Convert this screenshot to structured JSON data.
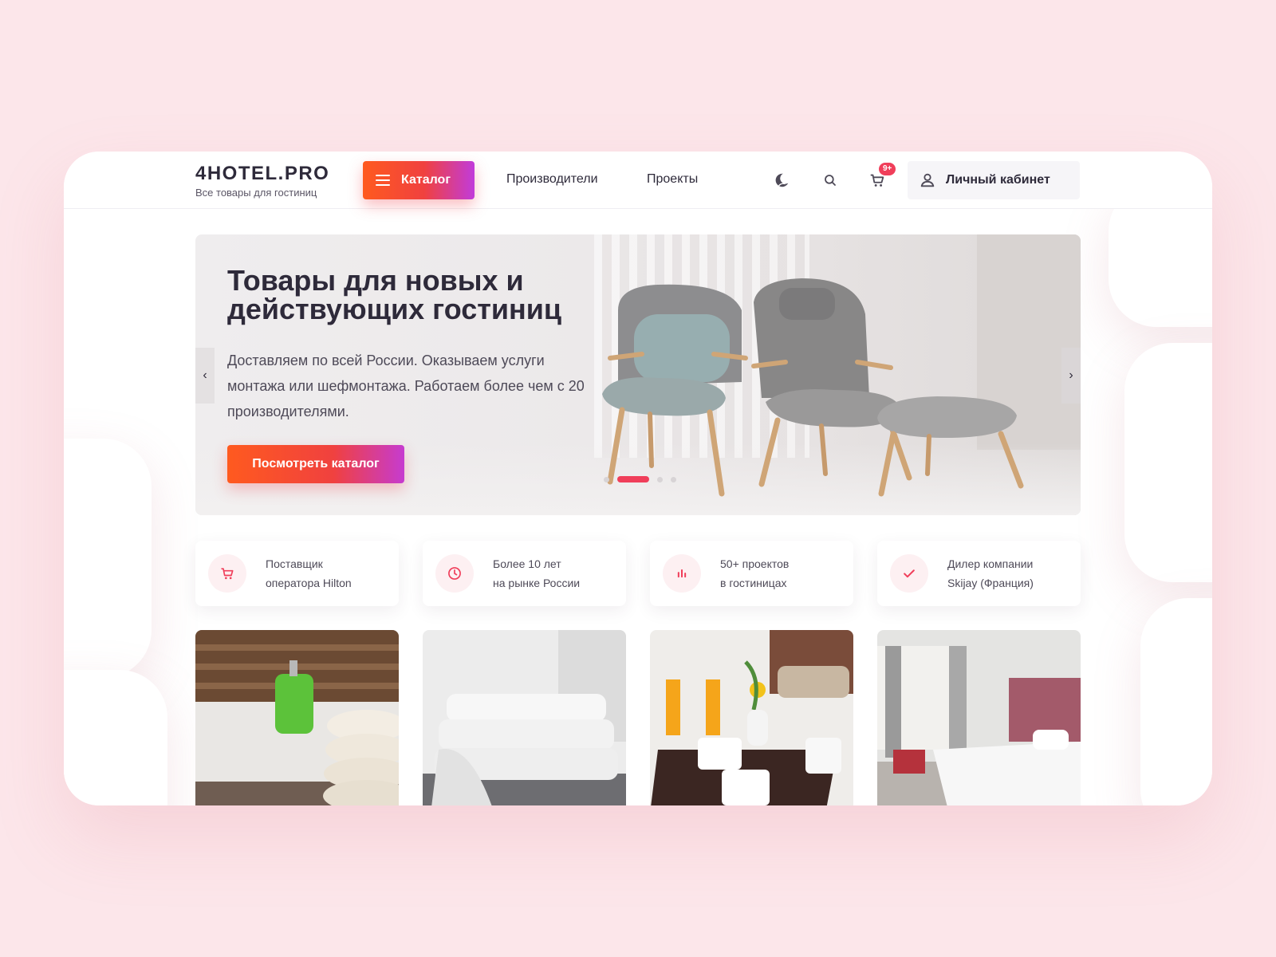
{
  "header": {
    "logo_title": "4HOTEL.PRO",
    "logo_subtitle": "Все товары для гостиниц",
    "catalog_label": "Каталог",
    "nav": [
      {
        "label": "Производители"
      },
      {
        "label": "Проекты"
      }
    ],
    "theme_icon": "moon-icon",
    "search_icon": "search-icon",
    "cart_icon": "cart-icon",
    "cart_badge": "9+",
    "account_icon": "user-icon",
    "account_label": "Личный кабинет"
  },
  "hero": {
    "title": "Товары для новых и действующих гостиниц",
    "text": "Доставляем по всей России. Оказываем услуги монтажа или шефмонтажа. Работаем более чем с 20 производителями.",
    "button_label": "Посмотреть каталог",
    "prev_arrow": "‹",
    "next_arrow": "›",
    "slides_total": 4,
    "active_slide": 2,
    "image": "chairs-with-footstool"
  },
  "features": [
    {
      "icon": "cart-icon",
      "line1": "Поставщик",
      "line2": "оператора Hilton"
    },
    {
      "icon": "clock-icon",
      "line1": "Более 10 лет",
      "line2": "на рынке России"
    },
    {
      "icon": "bar-chart-icon",
      "line1": "50+ проектов",
      "line2": "в гостиницах"
    },
    {
      "icon": "check-icon",
      "line1": "Дилер компании",
      "line2": "Skijay (Франция)"
    }
  ],
  "photos": [
    {
      "subject": "bathroom-towels"
    },
    {
      "subject": "folded-linens"
    },
    {
      "subject": "breakfast-tray"
    },
    {
      "subject": "hotel-room"
    }
  ],
  "colors": {
    "background": "#fce6ea",
    "accent_orange": "#ff5a1f",
    "accent_red": "#f03e5a",
    "accent_purple": "#c13bdb",
    "text_dark": "#2e2a3a"
  }
}
